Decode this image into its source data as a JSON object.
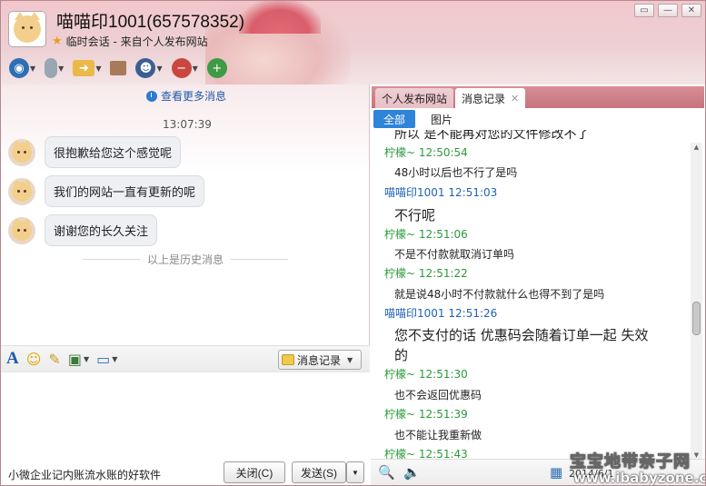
{
  "window": {
    "title": "喵喵印1001(657578352)",
    "subtitle": "临时会话 - 来自个人发布网站",
    "controls": [
      "minimize",
      "maximize",
      "close"
    ]
  },
  "toolbar": {
    "items": [
      {
        "name": "video-call",
        "icon": "camera-icon"
      },
      {
        "name": "voice-call",
        "icon": "microphone-icon"
      },
      {
        "name": "file-transfer",
        "icon": "folder-icon"
      },
      {
        "name": "remote-assist",
        "icon": "window-icon"
      },
      {
        "name": "profile",
        "icon": "user-icon"
      },
      {
        "name": "block",
        "icon": "user-remove-icon"
      },
      {
        "name": "add-friend",
        "icon": "user-add-icon"
      }
    ]
  },
  "chat": {
    "view_more": "查看更多消息",
    "time": "13:07:39",
    "messages": [
      {
        "text": "很抱歉给您这个感觉呢"
      },
      {
        "text": "我们的网站一直有更新的呢"
      },
      {
        "text": "谢谢您的长久关注"
      }
    ],
    "history_divider": "以上是历史消息"
  },
  "input_toolbar": {
    "history_button": "消息记录"
  },
  "bottom": {
    "ad_text": "小微企业记内账流水账的好软件",
    "close_button": "关闭(C)",
    "send_button": "发送(S)"
  },
  "side": {
    "tabs": [
      {
        "label": "个人发布网站"
      },
      {
        "label": "消息记录"
      }
    ],
    "subtabs": [
      {
        "label": "全部"
      },
      {
        "label": "图片"
      }
    ],
    "partial_line": "所以 是不能再对您的文件修改不了",
    "records": [
      {
        "who": "柠檬~",
        "time": "12:50:54",
        "sender": "peer",
        "text": "48小时以后也不行了是吗"
      },
      {
        "who": "喵喵印1001",
        "time": "12:51:03",
        "sender": "self",
        "text": "不行呢"
      },
      {
        "who": "柠檬~",
        "time": "12:51:06",
        "sender": "peer",
        "text": "不是不付款就取消订单吗"
      },
      {
        "who": "柠檬~",
        "time": "12:51:22",
        "sender": "peer",
        "text": "就是说48小时不付款就什么也得不到了是吗"
      },
      {
        "who": "喵喵印1001",
        "time": "12:51:26",
        "sender": "self",
        "text": "您不支付的话 优惠码会随着订单一起 失效",
        "text2": "的"
      },
      {
        "who": "柠檬~",
        "time": "12:51:30",
        "sender": "peer",
        "text": "也不会返回优惠码"
      },
      {
        "who": "柠檬~",
        "time": "12:51:39",
        "sender": "peer",
        "text": "也不能让我重新做"
      },
      {
        "who": "柠檬~",
        "time": "12:51:43",
        "sender": "peer",
        "text": ""
      }
    ],
    "date_partial": "2014/6/1"
  },
  "watermark": {
    "cn": "宝宝地带亲子网",
    "url": "www.ibabyzone.cn"
  },
  "colors": {
    "accent_blue": "#2d84d8",
    "peer_name": "#2a9a3a",
    "self_name": "#1d62b8",
    "title_pink": "#ecd0d3",
    "tab_bar": "#c6737d"
  }
}
